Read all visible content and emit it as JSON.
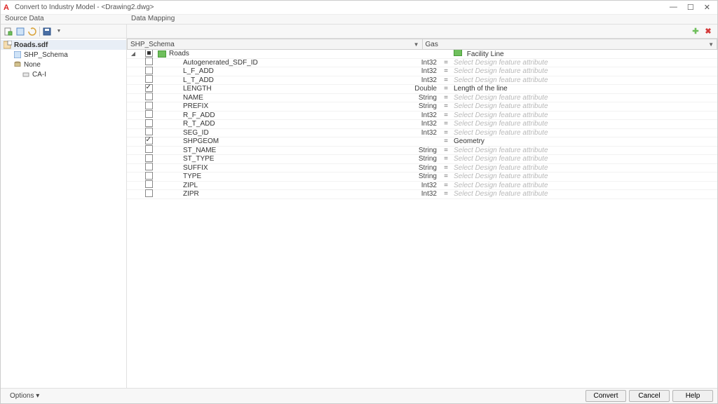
{
  "window": {
    "title": "Convert to Industry Model - <Drawing2.dwg>",
    "minimize": "—",
    "maximize": "☐",
    "close": "✕"
  },
  "panels": {
    "left_header": "Source Data",
    "right_header": "Data Mapping"
  },
  "toolbar_left": {
    "b1": "add-connection-icon",
    "b2": "properties-icon",
    "b3": "refresh-icon",
    "b4": "save-icon"
  },
  "toolbar_right": {
    "add": "✚",
    "remove": "✖"
  },
  "tree": {
    "root": "Roads.sdf",
    "schema": "SHP_Schema",
    "none": "None",
    "child": "CA-I"
  },
  "dropdowns": {
    "left": "SHP_Schema",
    "right": "Gas"
  },
  "feature_class": {
    "source": "Roads",
    "target": "Facility Line"
  },
  "placeholder": "Select Design feature attribute",
  "attributes": [
    {
      "name": "Autogenerated_SDF_ID",
      "type": "Int32",
      "checked": false,
      "mapped": ""
    },
    {
      "name": "L_F_ADD",
      "type": "Int32",
      "checked": false,
      "mapped": ""
    },
    {
      "name": "L_T_ADD",
      "type": "Int32",
      "checked": false,
      "mapped": ""
    },
    {
      "name": "LENGTH",
      "type": "Double",
      "checked": true,
      "mapped": "Length of the line"
    },
    {
      "name": "NAME",
      "type": "String",
      "checked": false,
      "mapped": ""
    },
    {
      "name": "PREFIX",
      "type": "String",
      "checked": false,
      "mapped": ""
    },
    {
      "name": "R_F_ADD",
      "type": "Int32",
      "checked": false,
      "mapped": ""
    },
    {
      "name": "R_T_ADD",
      "type": "Int32",
      "checked": false,
      "mapped": ""
    },
    {
      "name": "SEG_ID",
      "type": "Int32",
      "checked": false,
      "mapped": ""
    },
    {
      "name": "SHPGEOM",
      "type": "",
      "checked": true,
      "mapped": "Geometry"
    },
    {
      "name": "ST_NAME",
      "type": "String",
      "checked": false,
      "mapped": ""
    },
    {
      "name": "ST_TYPE",
      "type": "String",
      "checked": false,
      "mapped": ""
    },
    {
      "name": "SUFFIX",
      "type": "String",
      "checked": false,
      "mapped": ""
    },
    {
      "name": "TYPE",
      "type": "String",
      "checked": false,
      "mapped": ""
    },
    {
      "name": "ZIPL",
      "type": "Int32",
      "checked": false,
      "mapped": ""
    },
    {
      "name": "ZIPR",
      "type": "Int32",
      "checked": false,
      "mapped": ""
    }
  ],
  "footer": {
    "options": "Options ▾",
    "convert": "Convert",
    "cancel": "Cancel",
    "help": "Help"
  }
}
